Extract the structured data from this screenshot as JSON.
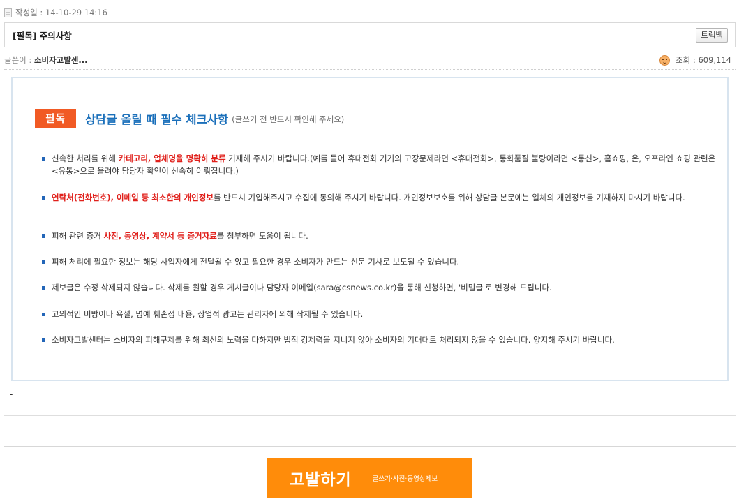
{
  "post": {
    "date_label": "작성일 : 14-10-29 14:16",
    "title": "[필독] 주의사항",
    "trackback_label": "트랙백",
    "author_label": "글쓴이 : ",
    "author_name": "소비자고발센...",
    "views_label": "조회 : 609,114"
  },
  "notice": {
    "badge": "필독",
    "title": "상담글 올릴 때 필수 체크사항",
    "subtitle": "(글쓰기 전 반드시 확인해 주세요)",
    "items": [
      {
        "pre": "신속한 처리를 위해 ",
        "hl": "카테고리, 업체명을 명확히 분류",
        "post": " 기재해 주시기 바랍니다.(예를 들어 휴대전화 기기의 고장문제라면 <휴대전화>, 통화품질 불량이라면 <통신>, 홈쇼핑, 온, 오프라인 쇼핑 관련은 <유통>으로 올려야 담당자 확인이 신속히 이뤄집니다.)"
      },
      {
        "pre": "",
        "hl": "연락처(전화번호), 이메일 등 최소한의 개인정보",
        "post": "를 반드시 기입해주시고 수집에 동의해 주시기 바랍니다. 개인정보보호를 위해 상담글 본문에는 일체의 개인정보를 기재하지 마시기 바랍니다."
      },
      {
        "pre": "피해 관련 증거 ",
        "hl": "사진, 동영상, 계약서 등 증거자료",
        "post": "를 첨부하면 도움이 됩니다."
      },
      {
        "pre": "피해 처리에 필요한 정보는 해당 사업자에게 전달될 수 있고 필요한 경우 소비자가 만드는 신문 기사로 보도될 수 있습니다.",
        "hl": "",
        "post": ""
      },
      {
        "pre": "제보글은 수정 삭제되지 않습니다.  삭제를 원할 경우 게시글이나 담당자 이메일(sara@csnews.co.kr)을 통해 신청하면, '비밀글'로 변경해 드립니다.",
        "hl": "",
        "post": ""
      },
      {
        "pre": "고의적인 비방이나 욕설, 명예 훼손성 내용, 상업적 광고는 관리자에 의해 삭제될 수 있습니다.",
        "hl": "",
        "post": ""
      },
      {
        "pre": "소비자고발센터는 소비자의 피해구제를 위해 최선의 노력을 다하지만 법적 강제력을 지니지 않아 소비자의 기대대로 처리되지 않을 수 있습니다. 양지해 주시기 바랍니다.",
        "hl": "",
        "post": ""
      }
    ]
  },
  "body_dash": "-",
  "report_button": {
    "label": "고발하기",
    "sub": "글쓰기·사진·동영상제보"
  },
  "colors": {
    "badge": "#f15a24",
    "title": "#1a6fba",
    "highlight": "#e0201b",
    "bullet": "#2366b8",
    "report_button": "#ff8c0a",
    "box_border": "#d8e4ef"
  },
  "icons": [
    "document-icon",
    "face-icon",
    "bullet-square-icon"
  ]
}
